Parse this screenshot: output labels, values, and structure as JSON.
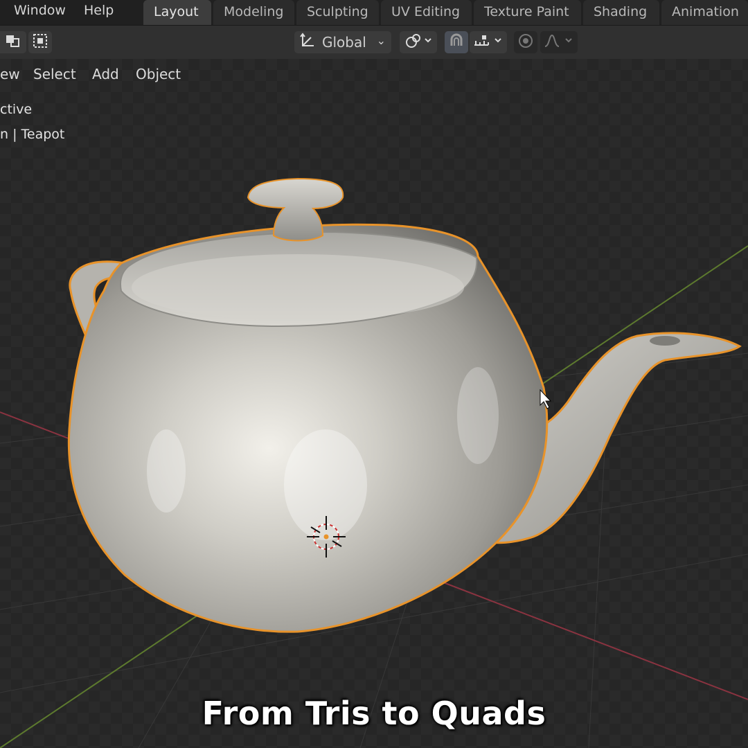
{
  "topbar": {
    "menus": [
      "Window",
      "Help"
    ],
    "workspace_tabs": [
      "Layout",
      "Modeling",
      "Sculpting",
      "UV Editing",
      "Texture Paint",
      "Shading",
      "Animation"
    ],
    "active_tab": "Layout"
  },
  "header": {
    "transform_orientation": "Global",
    "icons": [
      "select-box-icon",
      "select-lasso-icon",
      "orientation-icon",
      "pivot-icon",
      "snap-icon",
      "snap-increment-icon",
      "proportional-editing-icon",
      "falloff-icon"
    ]
  },
  "viewport": {
    "menus": [
      "ew",
      "Select",
      "Add",
      "Object"
    ],
    "info_line1": "ctive",
    "info_line2": "n | Teapot"
  },
  "caption": "From Tris to Quads",
  "colors": {
    "selection_outline": "#e8932a",
    "x_axis": "#8a3340",
    "y_axis": "#5d7a2e",
    "background": "#2a2a2a"
  }
}
